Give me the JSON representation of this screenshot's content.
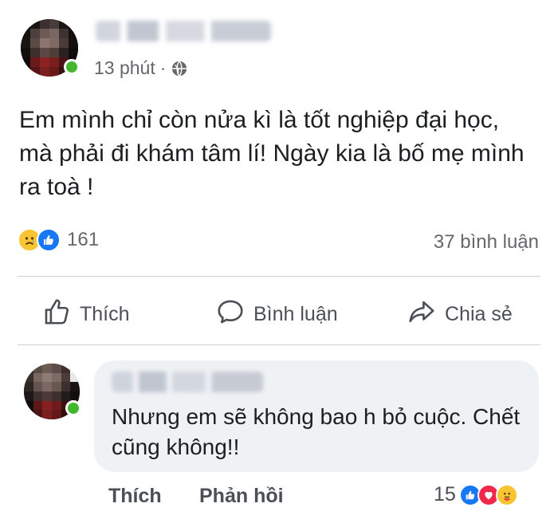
{
  "post": {
    "time": "13 phút",
    "separator": "·",
    "text": "Em mình chỉ còn nửa kì là tốt nghiệp đại học, mà phải đi khám tâm lí! Ngày kia là bố mẹ mình ra toà !",
    "reaction_count": "161",
    "comment_count": "37 bình luận"
  },
  "actions": {
    "like": "Thích",
    "comment": "Bình luận",
    "share": "Chia sẻ"
  },
  "comment": {
    "text": "Nhưng em sẽ không bao h bỏ cuộc. Chết cũng không!!",
    "like": "Thích",
    "reply": "Phản hồi",
    "reaction_count": "15"
  },
  "icons": {
    "post_reactions": [
      "sad-icon",
      "like-icon"
    ],
    "comment_reactions": [
      "like-icon",
      "love-icon",
      "care-icon"
    ],
    "privacy": "globe-icon"
  },
  "colors": {
    "online": "#44b72f",
    "like_blue": "#1877f2",
    "love_red": "#f0284a",
    "emoji_yellow": "#f7c531",
    "bubble": "#eff2f5",
    "muted": "#65676b"
  }
}
